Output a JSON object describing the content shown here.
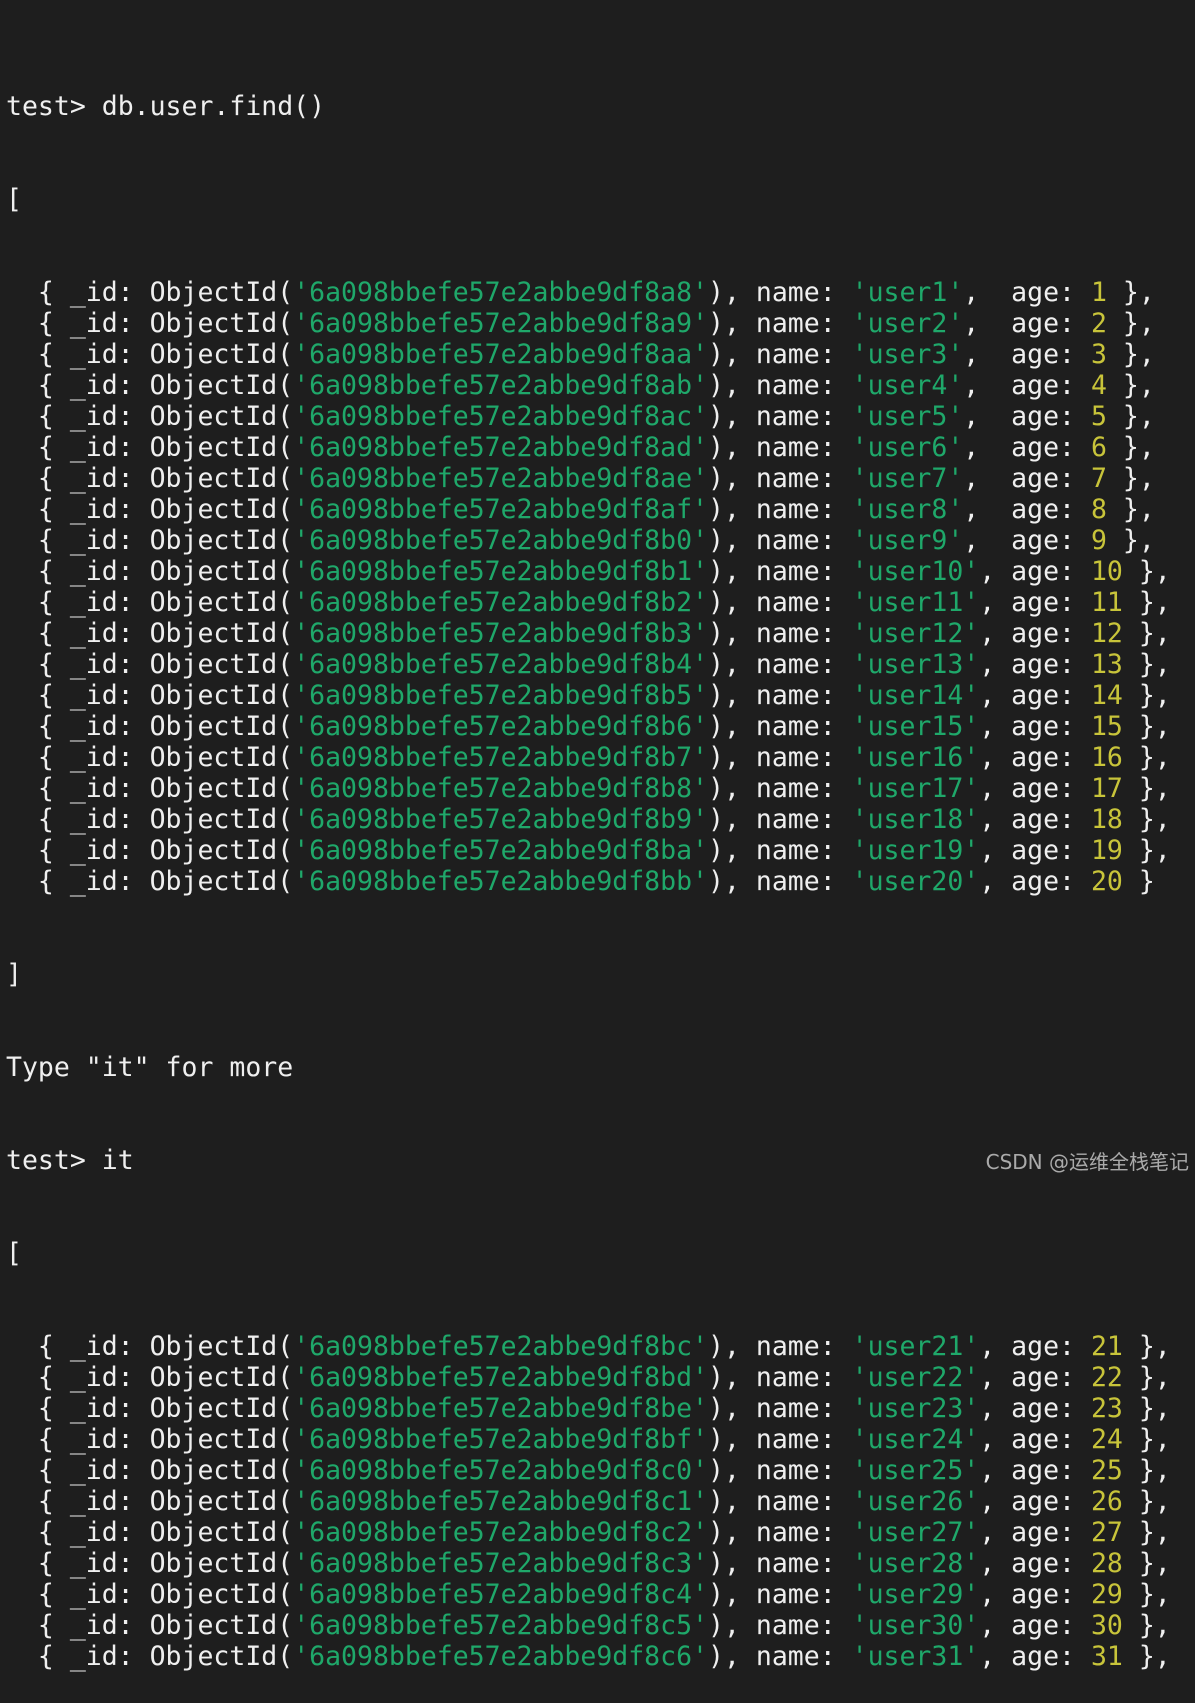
{
  "terminal": {
    "prompt": "test> ",
    "commands": [
      "db.user.find()",
      "it"
    ],
    "open_bracket": "[",
    "close_bracket": "]",
    "more_hint": "Type \"it\" for more",
    "watermark": "CSDN @运维全栈笔记",
    "colors": {
      "background": "#1e1e1e",
      "text": "#efefef",
      "string": "#1fa86a",
      "number": "#c8c43a"
    },
    "batch1": [
      {
        "id": "6a098bbefe57e2abbe9df8a8",
        "name": "user1",
        "age": 1
      },
      {
        "id": "6a098bbefe57e2abbe9df8a9",
        "name": "user2",
        "age": 2
      },
      {
        "id": "6a098bbefe57e2abbe9df8aa",
        "name": "user3",
        "age": 3
      },
      {
        "id": "6a098bbefe57e2abbe9df8ab",
        "name": "user4",
        "age": 4
      },
      {
        "id": "6a098bbefe57e2abbe9df8ac",
        "name": "user5",
        "age": 5
      },
      {
        "id": "6a098bbefe57e2abbe9df8ad",
        "name": "user6",
        "age": 6
      },
      {
        "id": "6a098bbefe57e2abbe9df8ae",
        "name": "user7",
        "age": 7
      },
      {
        "id": "6a098bbefe57e2abbe9df8af",
        "name": "user8",
        "age": 8
      },
      {
        "id": "6a098bbefe57e2abbe9df8b0",
        "name": "user9",
        "age": 9
      },
      {
        "id": "6a098bbefe57e2abbe9df8b1",
        "name": "user10",
        "age": 10
      },
      {
        "id": "6a098bbefe57e2abbe9df8b2",
        "name": "user11",
        "age": 11
      },
      {
        "id": "6a098bbefe57e2abbe9df8b3",
        "name": "user12",
        "age": 12
      },
      {
        "id": "6a098bbefe57e2abbe9df8b4",
        "name": "user13",
        "age": 13
      },
      {
        "id": "6a098bbefe57e2abbe9df8b5",
        "name": "user14",
        "age": 14
      },
      {
        "id": "6a098bbefe57e2abbe9df8b6",
        "name": "user15",
        "age": 15
      },
      {
        "id": "6a098bbefe57e2abbe9df8b7",
        "name": "user16",
        "age": 16
      },
      {
        "id": "6a098bbefe57e2abbe9df8b8",
        "name": "user17",
        "age": 17
      },
      {
        "id": "6a098bbefe57e2abbe9df8b9",
        "name": "user18",
        "age": 18
      },
      {
        "id": "6a098bbefe57e2abbe9df8ba",
        "name": "user19",
        "age": 19
      },
      {
        "id": "6a098bbefe57e2abbe9df8bb",
        "name": "user20",
        "age": 20
      }
    ],
    "batch2": [
      {
        "id": "6a098bbefe57e2abbe9df8bc",
        "name": "user21",
        "age": 21
      },
      {
        "id": "6a098bbefe57e2abbe9df8bd",
        "name": "user22",
        "age": 22
      },
      {
        "id": "6a098bbefe57e2abbe9df8be",
        "name": "user23",
        "age": 23
      },
      {
        "id": "6a098bbefe57e2abbe9df8bf",
        "name": "user24",
        "age": 24
      },
      {
        "id": "6a098bbefe57e2abbe9df8c0",
        "name": "user25",
        "age": 25
      },
      {
        "id": "6a098bbefe57e2abbe9df8c1",
        "name": "user26",
        "age": 26
      },
      {
        "id": "6a098bbefe57e2abbe9df8c2",
        "name": "user27",
        "age": 27
      },
      {
        "id": "6a098bbefe57e2abbe9df8c3",
        "name": "user28",
        "age": 28
      },
      {
        "id": "6a098bbefe57e2abbe9df8c4",
        "name": "user29",
        "age": 29
      },
      {
        "id": "6a098bbefe57e2abbe9df8c5",
        "name": "user30",
        "age": 30
      },
      {
        "id": "6a098bbefe57e2abbe9df8c6",
        "name": "user31",
        "age": 31
      }
    ]
  }
}
